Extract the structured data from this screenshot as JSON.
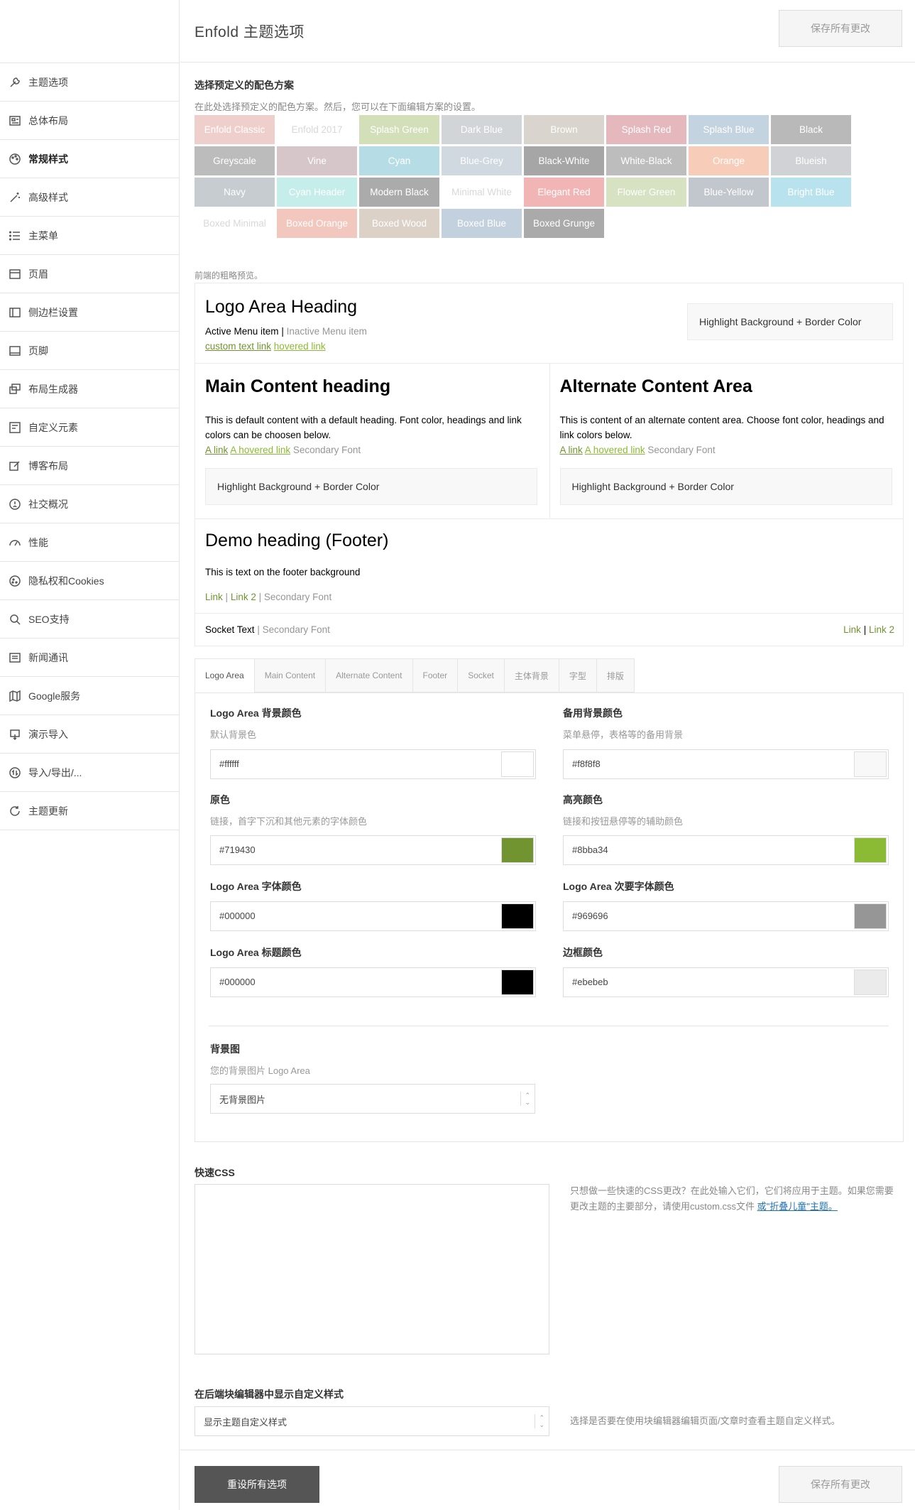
{
  "header": {
    "title": "Enfold 主题选项",
    "save_label": "保存所有更改"
  },
  "sidebar": {
    "items": [
      {
        "label": "主题选项",
        "icon": "wrench-icon"
      },
      {
        "label": "总体布局",
        "icon": "layout-icon"
      },
      {
        "label": "常规样式",
        "icon": "palette-icon",
        "active": true
      },
      {
        "label": "高级样式",
        "icon": "magic-wand-icon"
      },
      {
        "label": "主菜单",
        "icon": "menu-list-icon"
      },
      {
        "label": "页眉",
        "icon": "header-icon"
      },
      {
        "label": "侧边栏设置",
        "icon": "sidebar-icon"
      },
      {
        "label": "页脚",
        "icon": "footer-icon"
      },
      {
        "label": "布局生成器",
        "icon": "builder-icon"
      },
      {
        "label": "自定义元素",
        "icon": "custom-element-icon"
      },
      {
        "label": "博客布局",
        "icon": "edit-icon"
      },
      {
        "label": "社交概况",
        "icon": "social-icon"
      },
      {
        "label": "性能",
        "icon": "performance-icon"
      },
      {
        "label": "隐私权和Cookies",
        "icon": "cookie-icon"
      },
      {
        "label": "SEO支持",
        "icon": "search-icon"
      },
      {
        "label": "新闻通讯",
        "icon": "newsletter-icon"
      },
      {
        "label": "Google服务",
        "icon": "map-icon"
      },
      {
        "label": "演示导入",
        "icon": "import-icon"
      },
      {
        "label": "导入/导出/...",
        "icon": "export-icon"
      },
      {
        "label": "主题更新",
        "icon": "refresh-icon"
      }
    ]
  },
  "scheme": {
    "label": "选择预定义的配色方案",
    "desc": "在此处选择预定义的配色方案。然后，您可以在下面编辑方案的设置。",
    "swatches": [
      {
        "label": "Enfold Classic",
        "bg": "#efcfcc",
        "fg": "#ffffff"
      },
      {
        "label": "Enfold 2017",
        "bg": "#ffffff",
        "fg": "#d8d8d8"
      },
      {
        "label": "Splash Green",
        "bg": "#d3dfb8",
        "fg": "#ffffff"
      },
      {
        "label": "Dark Blue",
        "bg": "#d2d5d8",
        "fg": "#ffffff"
      },
      {
        "label": "Brown",
        "bg": "#d9d4cd",
        "fg": "#ffffff"
      },
      {
        "label": "Splash Red",
        "bg": "#e4b8bd",
        "fg": "#ffffff"
      },
      {
        "label": "Splash Blue",
        "bg": "#c4d3e0",
        "fg": "#ffffff"
      },
      {
        "label": "Black",
        "bg": "#b9b9b9",
        "fg": "#ffffff"
      },
      {
        "label": "Greyscale",
        "bg": "#bcbcbc",
        "fg": "#ffffff"
      },
      {
        "label": "Vine",
        "bg": "#d6c6c9",
        "fg": "#ffffff"
      },
      {
        "label": "Cyan",
        "bg": "#b6dde5",
        "fg": "#ffffff"
      },
      {
        "label": "Blue-Grey",
        "bg": "#d0d8e0",
        "fg": "#ffffff"
      },
      {
        "label": "Black-White",
        "bg": "#a6a6a6",
        "fg": "#ffffff"
      },
      {
        "label": "White-Black",
        "bg": "#bdbdbd",
        "fg": "#ffffff"
      },
      {
        "label": "Orange",
        "bg": "#f7cdb9",
        "fg": "#ffffff"
      },
      {
        "label": "Blueish",
        "bg": "#d0d2d5",
        "fg": "#ffffff"
      },
      {
        "label": "Navy",
        "bg": "#c6cccf",
        "fg": "#ffffff"
      },
      {
        "label": "Cyan Header",
        "bg": "#c5ede9",
        "fg": "#ffffff"
      },
      {
        "label": "Modern Black",
        "bg": "#ababab",
        "fg": "#ffffff"
      },
      {
        "label": "Minimal White",
        "bg": "#ffffff",
        "fg": "#d8d8d8"
      },
      {
        "label": "Elegant Red",
        "bg": "#f2b5b5",
        "fg": "#ffffff"
      },
      {
        "label": "Flower Green",
        "bg": "#d6e2c1",
        "fg": "#ffffff"
      },
      {
        "label": "Blue-Yellow",
        "bg": "#c2c6cd",
        "fg": "#ffffff"
      },
      {
        "label": "Bright Blue",
        "bg": "#b8e3ee",
        "fg": "#ffffff"
      },
      {
        "label": "Boxed Minimal",
        "bg": "#ffffff",
        "fg": "#d8d8d8"
      },
      {
        "label": "Boxed Orange",
        "bg": "#f2c7bd",
        "fg": "#ffffff"
      },
      {
        "label": "Boxed Wood",
        "bg": "#dbd1c7",
        "fg": "#ffffff"
      },
      {
        "label": "Boxed Blue",
        "bg": "#c3d0dd",
        "fg": "#ffffff"
      },
      {
        "label": "Boxed Grunge",
        "bg": "#aaaaaa",
        "fg": "#ffffff"
      }
    ]
  },
  "preview": {
    "label": "前端的粗略预览。",
    "logo_heading": "Logo Area Heading",
    "active_menu": "Active Menu item",
    "sep": "|",
    "inactive_menu": "Inactive Menu item",
    "custom_link": "custom text link",
    "hovered_link": "hovered link",
    "highlight": "Highlight Background + Border Color",
    "main_heading": "Main Content heading",
    "main_text": "This is default content with a default heading. Font color, headings and link colors can be choosen below.",
    "alt_heading": "Alternate Content Area",
    "alt_text": "This is content of an alternate content area. Choose font color, headings and link colors below.",
    "a_link": "A link",
    "a_hovered": "A hovered link",
    "secondary": "Secondary Font",
    "footer_heading": "Demo heading (Footer)",
    "footer_text": "This is text on the footer background",
    "link": "Link",
    "link2": "Link 2",
    "socket_text": "Socket Text"
  },
  "tabs": [
    {
      "label": "Logo Area",
      "active": true
    },
    {
      "label": "Main Content"
    },
    {
      "label": "Alternate Content"
    },
    {
      "label": "Footer"
    },
    {
      "label": "Socket"
    },
    {
      "label": "主体背景"
    },
    {
      "label": "字型"
    },
    {
      "label": "排版"
    }
  ],
  "fields": [
    {
      "label": "Logo Area 背景颜色",
      "desc": "默认背景色",
      "value": "#ffffff",
      "color": "#ffffff"
    },
    {
      "label": "备用背景颜色",
      "desc": "菜单悬停，表格等的备用背景",
      "value": "#f8f8f8",
      "color": "#f8f8f8"
    },
    {
      "label": "原色",
      "desc": "链接，首字下沉和其他元素的字体颜色",
      "value": "#719430",
      "color": "#719430"
    },
    {
      "label": "高亮颜色",
      "desc": "链接和按钮悬停等的辅助颜色",
      "value": "#8bba34",
      "color": "#8bba34"
    },
    {
      "label": "Logo Area 字体颜色",
      "desc": "",
      "value": "#000000",
      "color": "#000000"
    },
    {
      "label": "Logo Area 次要字体颜色",
      "desc": "",
      "value": "#969696",
      "color": "#969696"
    },
    {
      "label": "Logo Area 标题颜色",
      "desc": "",
      "value": "#000000",
      "color": "#000000"
    },
    {
      "label": "边框颜色",
      "desc": "",
      "value": "#ebebeb",
      "color": "#ebebeb"
    }
  ],
  "bg_image": {
    "label": "背景图",
    "desc": "您的背景图片 Logo Area",
    "value": "无背景图片"
  },
  "quick_css": {
    "label": "快速CSS",
    "note": "只想做一些快速的CSS更改？在此处输入它们，它们将应用于主题。如果您需要更改主题的主要部分，请使用custom.css文件",
    "note_link": "或\"折叠儿童\"主题。"
  },
  "block_editor": {
    "label": "在后端块编辑器中显示自定义样式",
    "value": "显示主题自定义样式",
    "note": "选择是否要在使用块编辑器编辑页面/文章时查看主题自定义样式。"
  },
  "footer_bar": {
    "reset_label": "重设所有选项",
    "save_label": "保存所有更改"
  }
}
